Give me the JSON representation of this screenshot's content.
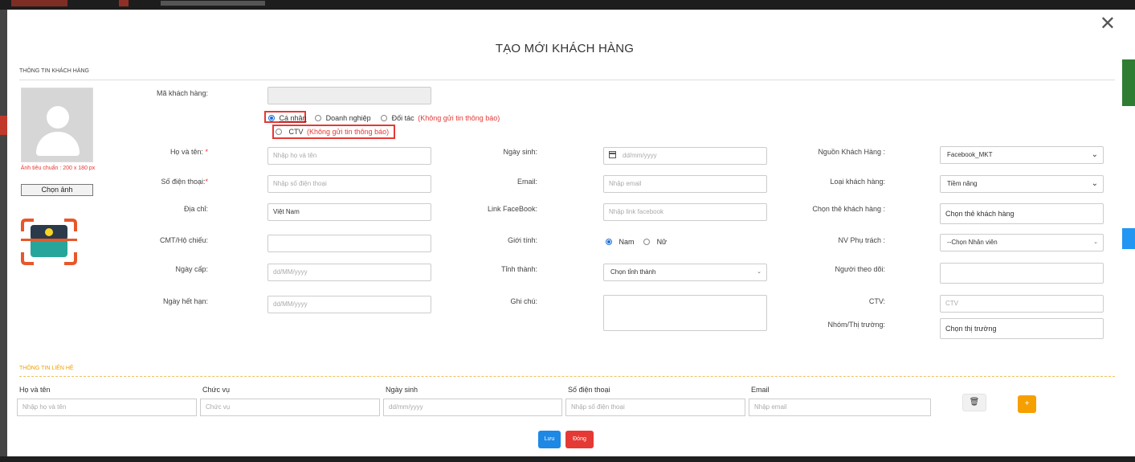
{
  "modal": {
    "title": "TẠO MỚI KHÁCH HÀNG",
    "close_icon": "✕",
    "section_info": "THÔNG TIN KHÁCH HÀNG",
    "section_contact": "THÔNG TIN LIÊN HỆ"
  },
  "avatar": {
    "hint": "Ảnh tiêu chuẩn : 200 x 180 px",
    "choose_label": "Chọn ảnh"
  },
  "form": {
    "ma_kh_label": "Mã khách hàng:",
    "ma_kh_value": "",
    "type_options": {
      "ca_nhan": "Cá nhân",
      "doanh_nghiep": "Doanh nghiệp",
      "doi_tac": "Đối tác",
      "doi_tac_note": "(Không gửi tin thông báo)",
      "ctv": "CTV",
      "ctv_note": "(Không gửi tin thông báo)"
    },
    "ho_ten_label": "Họ và tên:",
    "required_mark": "*",
    "ho_ten_ph": "Nhập họ và tên",
    "sdt_label": "Số điện thoại:",
    "sdt_ph": "Nhập số điện thoại",
    "dia_chi_label": "Địa chỉ:",
    "dia_chi_value": "Việt Nam",
    "cmt_label": "CMT/Hộ chiếu:",
    "cmt_value": "",
    "ngay_cap_label": "Ngày cấp:",
    "ngay_cap_ph": "dd/MM/yyyy",
    "ngay_het_han_label": "Ngày hết hạn:",
    "ngay_het_han_ph": "dd/MM/yyyy",
    "ngay_sinh_label": "Ngày sinh:",
    "ngay_sinh_ph": "dd/mm/yyyy",
    "email_label": "Email:",
    "email_ph": "Nhập email",
    "fb_label": "Link FaceBook:",
    "fb_ph": "Nhập link facebook",
    "gioi_tinh_label": "Giới tính:",
    "nam": "Nam",
    "nu": "Nữ",
    "tinh_label": "Tỉnh thành:",
    "tinh_value": "Chọn tỉnh thành",
    "ghi_chu_label": "Ghi chú:",
    "nguon_label": "Nguồn Khách Hàng :",
    "nguon_value": "Facebook_MKT",
    "loai_label": "Loại khách hàng:",
    "loai_value": "Tiềm năng",
    "the_label": "Chọn thẻ khách hàng :",
    "the_value": "Chọn thẻ khách hàng",
    "nv_label": "NV Phụ trách :",
    "nv_value": "--Chọn Nhân viên",
    "theo_doi_label": "Người theo dõi:",
    "ctv_label": "CTV:",
    "ctv_ph": "CTV",
    "nhom_label": "Nhóm/Thị trường:",
    "nhom_value": "Chọn thị trường"
  },
  "contact": {
    "headers": [
      "Họ và tên",
      "Chức vụ",
      "Ngày sinh",
      "Số điện thoại",
      "Email"
    ],
    "placeholders": [
      "Nhập họ và tên",
      "Chức vụ",
      "dd/mm/yyyy",
      "Nhập số điện thoại",
      "Nhập email"
    ],
    "delete_icon": "🗑",
    "add_icon": "+"
  },
  "buttons": {
    "save": "Lưu",
    "close": "Đóng"
  },
  "colors": {
    "primary": "#1e88e5",
    "danger": "#e53935",
    "warning": "#f5a000"
  }
}
